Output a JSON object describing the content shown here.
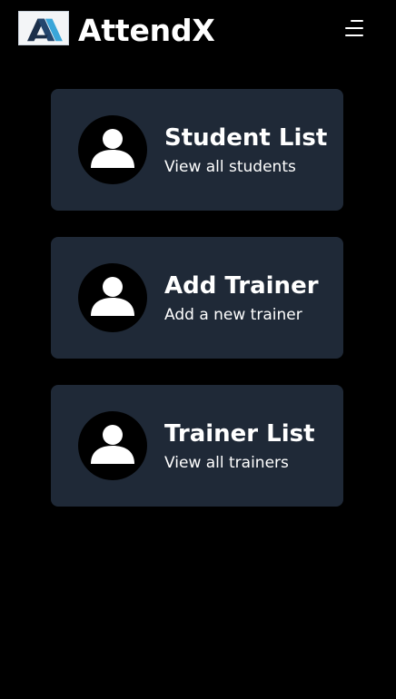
{
  "header": {
    "app_name": "AttendX",
    "logo_icon": "attendx-logo-icon",
    "menu_icon": "hamburger-menu-icon"
  },
  "colors": {
    "background": "#000000",
    "card": "#1f2937",
    "text": "#ffffff",
    "logo_dark": "#1b2f4a",
    "logo_accent": "#3aa6d9"
  },
  "cards": [
    {
      "title": "Student List",
      "subtitle": "View all students",
      "icon": "user-icon"
    },
    {
      "title": "Add Trainer",
      "subtitle": "Add a new trainer",
      "icon": "user-icon"
    },
    {
      "title": "Trainer List",
      "subtitle": "View all trainers",
      "icon": "user-icon"
    }
  ]
}
